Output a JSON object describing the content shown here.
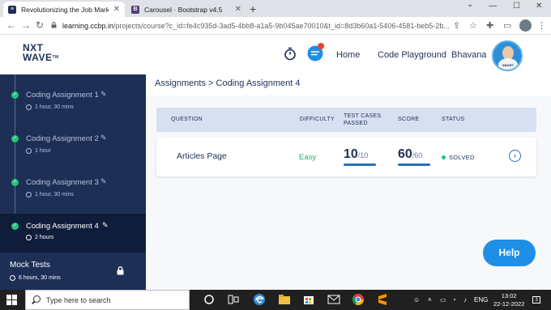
{
  "browser": {
    "tabs": [
      {
        "title": "Revolutionizing the Job Market |",
        "active": true,
        "favicon_color": "#1e2f56"
      },
      {
        "title": "Carousel · Bootstrap v4.5",
        "active": false,
        "favicon_color": "#563d7c",
        "favicon_letter": "B"
      }
    ],
    "url_host": "learning.ccbp.in",
    "url_path": "/projects/course?c_id=fe4c935d-3ad5-4bb8-a1a5-9b045ae70010&t_id=8d3b60a1-5406-4581-beb5-2b..."
  },
  "header": {
    "logo_line1": "NXT",
    "logo_line2": "WAVE",
    "logo_tm": "TM",
    "nav": {
      "home": "Home",
      "playground": "Code Playground",
      "user": "Bhavana"
    },
    "avatar_tag": "SMART",
    "accent": "#1e2f56"
  },
  "sidebar": {
    "assignments": [
      {
        "name": "Coding Assignment 1",
        "duration": "1 hour, 30 mins",
        "active": false
      },
      {
        "name": "Coding Assignment 2",
        "duration": "1 hour",
        "active": false
      },
      {
        "name": "Coding Assignment 3",
        "duration": "1 hour, 30 mins",
        "active": false
      },
      {
        "name": "Coding Assignment 4",
        "duration": "2 hours",
        "active": true
      }
    ],
    "mock": {
      "title": "Mock Tests",
      "duration": "6 hours, 30 mins"
    }
  },
  "main": {
    "breadcrumb": "Assignments > Coding Assignment 4",
    "columns": {
      "question": "QUESTION",
      "difficulty": "DIFFICULTY",
      "testcases_1": "TEST CASES",
      "testcases_2": "PASSED",
      "score": "SCORE",
      "status": "STATUS"
    },
    "row": {
      "question": "Articles Page",
      "difficulty": "Easy",
      "passed": "10",
      "passed_total": "/10",
      "score": "60",
      "score_total": "/60",
      "status": "SOLVED"
    },
    "help": "Help"
  },
  "taskbar": {
    "search_placeholder": "Type here to search",
    "lang": "ENG",
    "time": "13:02",
    "date": "22-12-2022",
    "badge": "3"
  }
}
